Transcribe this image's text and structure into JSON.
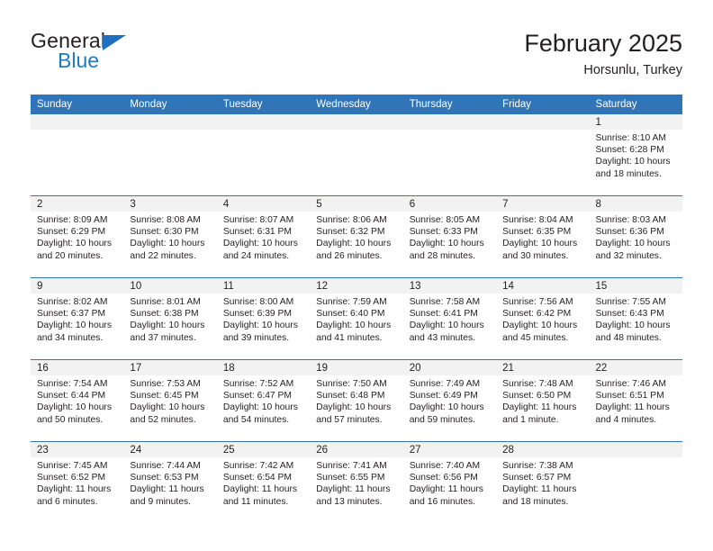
{
  "brand": {
    "name_part1": "General",
    "name_part2": "Blue",
    "accent_color": "#1f7ac4",
    "header_color": "#3075b8"
  },
  "header": {
    "title": "February 2025",
    "location": "Horsunlu, Turkey"
  },
  "weekday_headers": [
    "Sunday",
    "Monday",
    "Tuesday",
    "Wednesday",
    "Thursday",
    "Friday",
    "Saturday"
  ],
  "labels": {
    "sunrise": "Sunrise:",
    "sunset": "Sunset:",
    "daylight": "Daylight:"
  },
  "weeks": [
    [
      {
        "day": "",
        "sunrise": "",
        "sunset": "",
        "daylight": ""
      },
      {
        "day": "",
        "sunrise": "",
        "sunset": "",
        "daylight": ""
      },
      {
        "day": "",
        "sunrise": "",
        "sunset": "",
        "daylight": ""
      },
      {
        "day": "",
        "sunrise": "",
        "sunset": "",
        "daylight": ""
      },
      {
        "day": "",
        "sunrise": "",
        "sunset": "",
        "daylight": ""
      },
      {
        "day": "",
        "sunrise": "",
        "sunset": "",
        "daylight": ""
      },
      {
        "day": "1",
        "sunrise": "Sunrise: 8:10 AM",
        "sunset": "Sunset: 6:28 PM",
        "daylight": "Daylight: 10 hours and 18 minutes."
      }
    ],
    [
      {
        "day": "2",
        "sunrise": "Sunrise: 8:09 AM",
        "sunset": "Sunset: 6:29 PM",
        "daylight": "Daylight: 10 hours and 20 minutes."
      },
      {
        "day": "3",
        "sunrise": "Sunrise: 8:08 AM",
        "sunset": "Sunset: 6:30 PM",
        "daylight": "Daylight: 10 hours and 22 minutes."
      },
      {
        "day": "4",
        "sunrise": "Sunrise: 8:07 AM",
        "sunset": "Sunset: 6:31 PM",
        "daylight": "Daylight: 10 hours and 24 minutes."
      },
      {
        "day": "5",
        "sunrise": "Sunrise: 8:06 AM",
        "sunset": "Sunset: 6:32 PM",
        "daylight": "Daylight: 10 hours and 26 minutes."
      },
      {
        "day": "6",
        "sunrise": "Sunrise: 8:05 AM",
        "sunset": "Sunset: 6:33 PM",
        "daylight": "Daylight: 10 hours and 28 minutes."
      },
      {
        "day": "7",
        "sunrise": "Sunrise: 8:04 AM",
        "sunset": "Sunset: 6:35 PM",
        "daylight": "Daylight: 10 hours and 30 minutes."
      },
      {
        "day": "8",
        "sunrise": "Sunrise: 8:03 AM",
        "sunset": "Sunset: 6:36 PM",
        "daylight": "Daylight: 10 hours and 32 minutes."
      }
    ],
    [
      {
        "day": "9",
        "sunrise": "Sunrise: 8:02 AM",
        "sunset": "Sunset: 6:37 PM",
        "daylight": "Daylight: 10 hours and 34 minutes."
      },
      {
        "day": "10",
        "sunrise": "Sunrise: 8:01 AM",
        "sunset": "Sunset: 6:38 PM",
        "daylight": "Daylight: 10 hours and 37 minutes."
      },
      {
        "day": "11",
        "sunrise": "Sunrise: 8:00 AM",
        "sunset": "Sunset: 6:39 PM",
        "daylight": "Daylight: 10 hours and 39 minutes."
      },
      {
        "day": "12",
        "sunrise": "Sunrise: 7:59 AM",
        "sunset": "Sunset: 6:40 PM",
        "daylight": "Daylight: 10 hours and 41 minutes."
      },
      {
        "day": "13",
        "sunrise": "Sunrise: 7:58 AM",
        "sunset": "Sunset: 6:41 PM",
        "daylight": "Daylight: 10 hours and 43 minutes."
      },
      {
        "day": "14",
        "sunrise": "Sunrise: 7:56 AM",
        "sunset": "Sunset: 6:42 PM",
        "daylight": "Daylight: 10 hours and 45 minutes."
      },
      {
        "day": "15",
        "sunrise": "Sunrise: 7:55 AM",
        "sunset": "Sunset: 6:43 PM",
        "daylight": "Daylight: 10 hours and 48 minutes."
      }
    ],
    [
      {
        "day": "16",
        "sunrise": "Sunrise: 7:54 AM",
        "sunset": "Sunset: 6:44 PM",
        "daylight": "Daylight: 10 hours and 50 minutes."
      },
      {
        "day": "17",
        "sunrise": "Sunrise: 7:53 AM",
        "sunset": "Sunset: 6:45 PM",
        "daylight": "Daylight: 10 hours and 52 minutes."
      },
      {
        "day": "18",
        "sunrise": "Sunrise: 7:52 AM",
        "sunset": "Sunset: 6:47 PM",
        "daylight": "Daylight: 10 hours and 54 minutes."
      },
      {
        "day": "19",
        "sunrise": "Sunrise: 7:50 AM",
        "sunset": "Sunset: 6:48 PM",
        "daylight": "Daylight: 10 hours and 57 minutes."
      },
      {
        "day": "20",
        "sunrise": "Sunrise: 7:49 AM",
        "sunset": "Sunset: 6:49 PM",
        "daylight": "Daylight: 10 hours and 59 minutes."
      },
      {
        "day": "21",
        "sunrise": "Sunrise: 7:48 AM",
        "sunset": "Sunset: 6:50 PM",
        "daylight": "Daylight: 11 hours and 1 minute."
      },
      {
        "day": "22",
        "sunrise": "Sunrise: 7:46 AM",
        "sunset": "Sunset: 6:51 PM",
        "daylight": "Daylight: 11 hours and 4 minutes."
      }
    ],
    [
      {
        "day": "23",
        "sunrise": "Sunrise: 7:45 AM",
        "sunset": "Sunset: 6:52 PM",
        "daylight": "Daylight: 11 hours and 6 minutes."
      },
      {
        "day": "24",
        "sunrise": "Sunrise: 7:44 AM",
        "sunset": "Sunset: 6:53 PM",
        "daylight": "Daylight: 11 hours and 9 minutes."
      },
      {
        "day": "25",
        "sunrise": "Sunrise: 7:42 AM",
        "sunset": "Sunset: 6:54 PM",
        "daylight": "Daylight: 11 hours and 11 minutes."
      },
      {
        "day": "26",
        "sunrise": "Sunrise: 7:41 AM",
        "sunset": "Sunset: 6:55 PM",
        "daylight": "Daylight: 11 hours and 13 minutes."
      },
      {
        "day": "27",
        "sunrise": "Sunrise: 7:40 AM",
        "sunset": "Sunset: 6:56 PM",
        "daylight": "Daylight: 11 hours and 16 minutes."
      },
      {
        "day": "28",
        "sunrise": "Sunrise: 7:38 AM",
        "sunset": "Sunset: 6:57 PM",
        "daylight": "Daylight: 11 hours and 18 minutes."
      },
      {
        "day": "",
        "sunrise": "",
        "sunset": "",
        "daylight": ""
      }
    ]
  ]
}
